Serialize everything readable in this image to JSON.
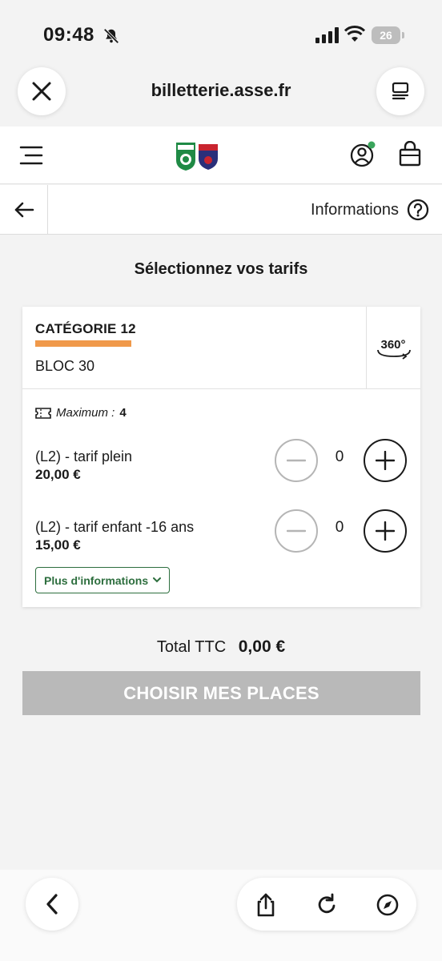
{
  "status_bar": {
    "time": "09:48",
    "battery": "26"
  },
  "browser": {
    "url": "billetterie.asse.fr"
  },
  "subnav": {
    "info_label": "Informations"
  },
  "page": {
    "title": "Sélectionnez vos tarifs"
  },
  "category": {
    "name": "CATÉGORIE 12",
    "color": "#f0994a",
    "bloc": "BLOC 30",
    "view_label": "360°"
  },
  "maximum": {
    "label": "Maximum :",
    "value": "4"
  },
  "tarifs": [
    {
      "name": "(L2) - tarif plein",
      "price": "20,00 €",
      "quantity": "0"
    },
    {
      "name": "(L2) - tarif enfant -16 ans",
      "price": "15,00 €",
      "quantity": "0"
    }
  ],
  "more_info_label": "Plus d'informations",
  "total": {
    "label": "Total TTC",
    "amount": "0,00 €"
  },
  "cta": {
    "label": "CHOISIR MES PLACES"
  },
  "colors": {
    "accent_green": "#2d6e3e",
    "disabled": "#b9b9b9",
    "category_bar": "#f0994a",
    "status_dot": "#3aa55c"
  }
}
